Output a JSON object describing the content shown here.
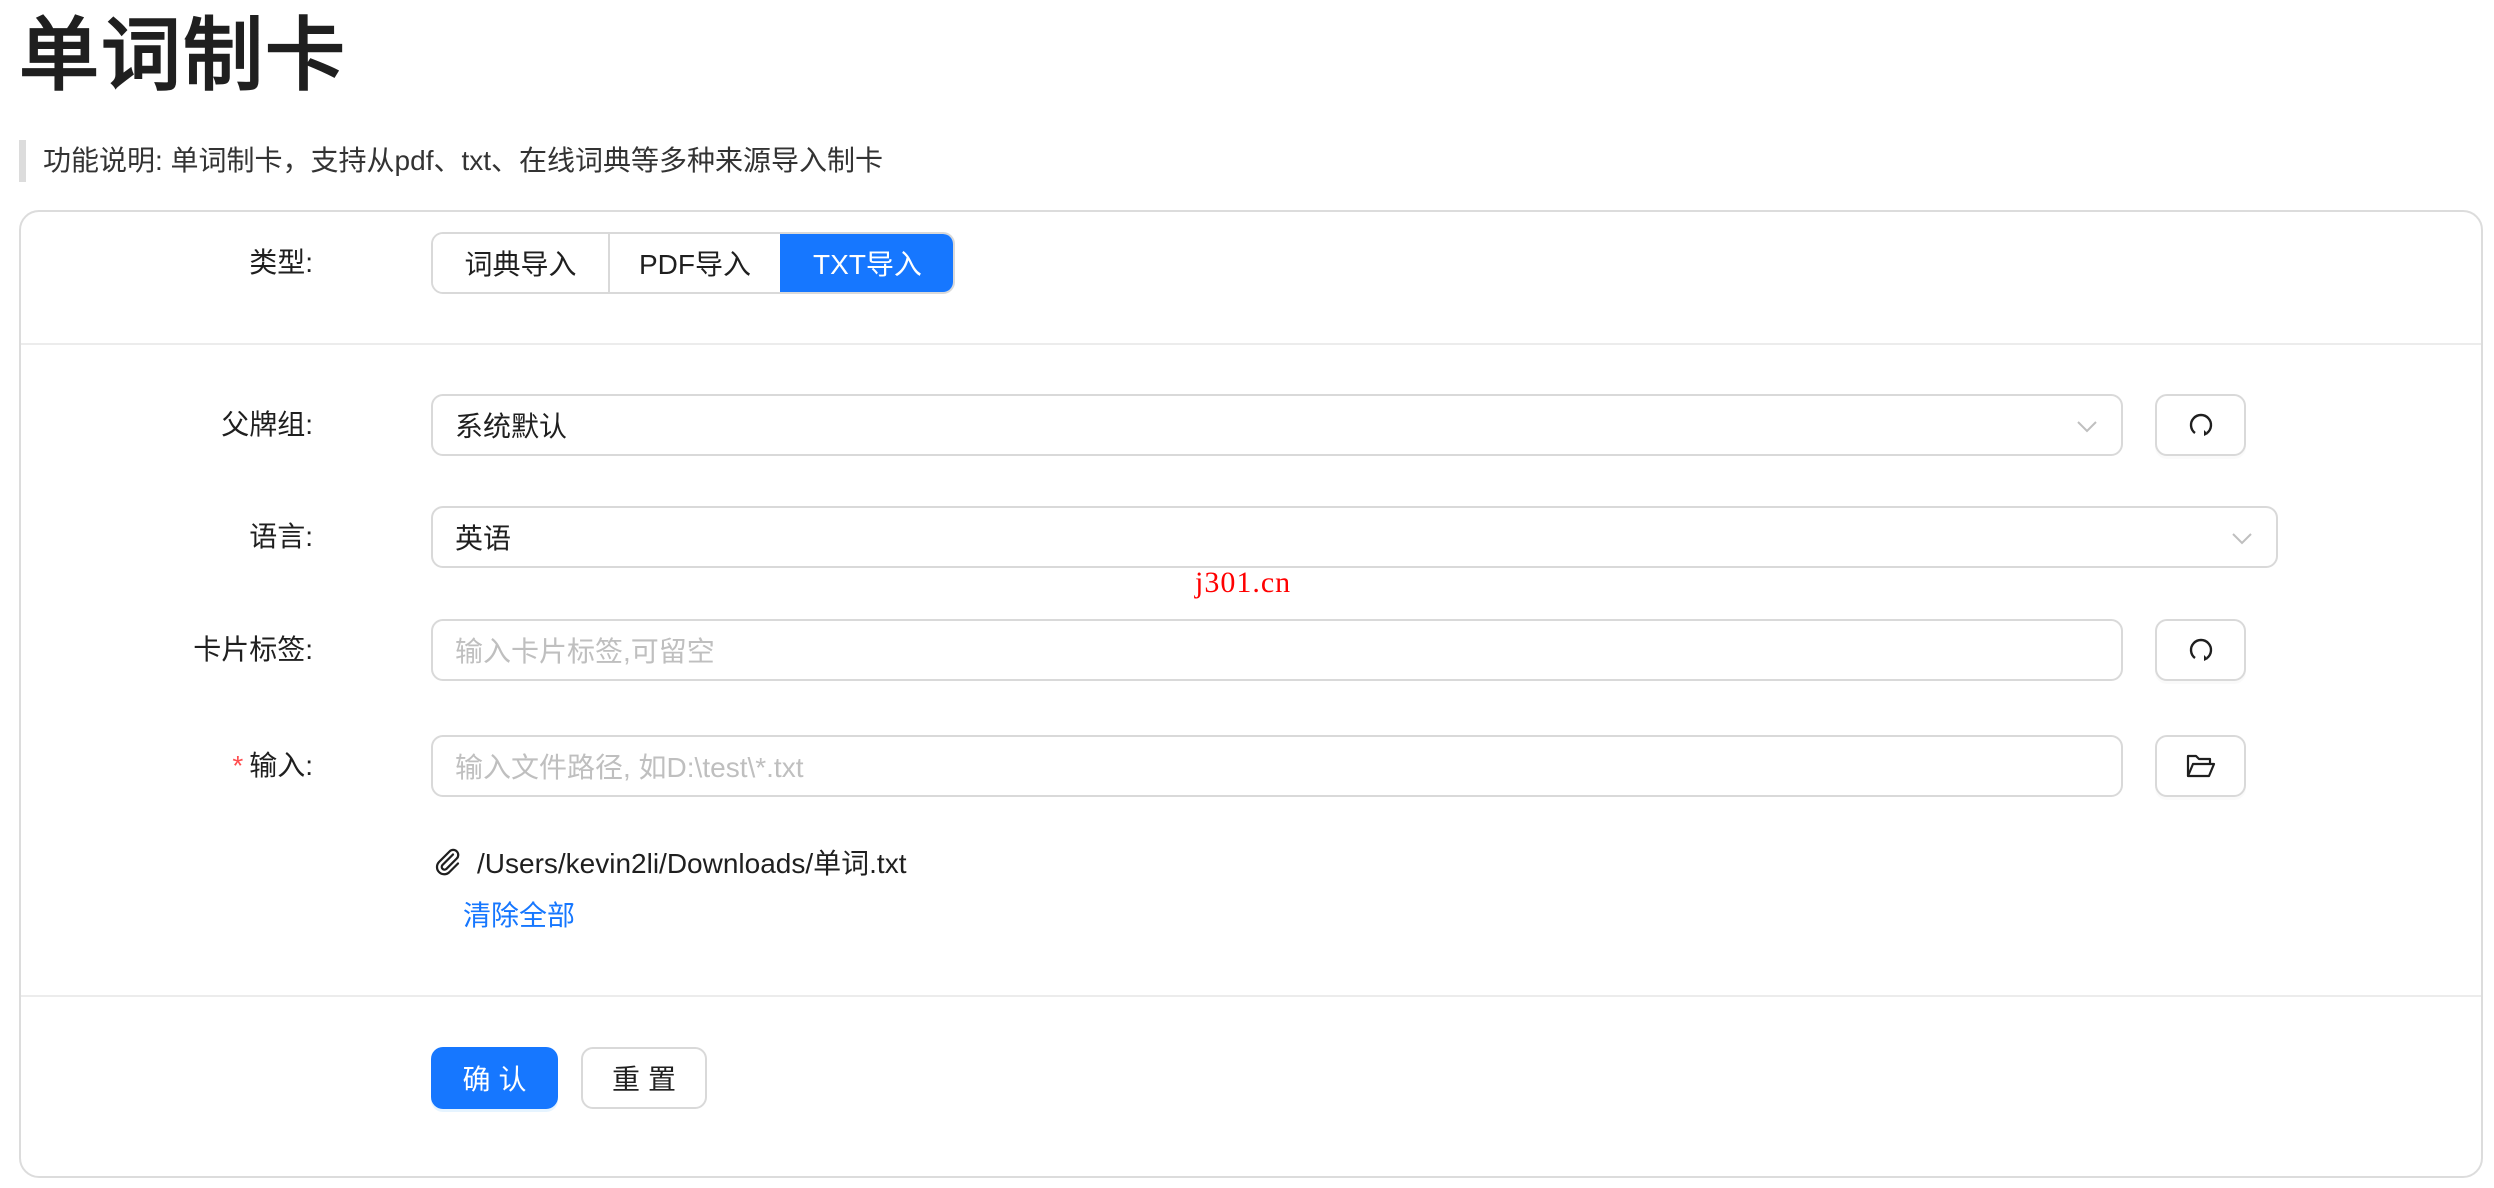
{
  "page": {
    "title": "单词制卡",
    "description": "功能说明: 单词制卡，支持从pdf、txt、在线词典等多种来源导入制卡"
  },
  "form": {
    "type": {
      "label": "类型:",
      "options": [
        "词典导入",
        "PDF导入",
        "TXT导入"
      ],
      "selected": "TXT导入"
    },
    "parent_deck": {
      "label": "父牌组:",
      "value": "系统默认",
      "refresh_icon": "refresh-icon"
    },
    "language": {
      "label": "语言:",
      "value": "英语"
    },
    "card_tags": {
      "label": "卡片标签:",
      "placeholder": "输入卡片标签,可留空",
      "value": "",
      "refresh_icon": "refresh-icon"
    },
    "input": {
      "required_mark": "*",
      "label": "输入:",
      "placeholder": "输入文件路径, 如D:\\test\\*.txt",
      "value": "",
      "browse_icon": "folder-open-icon"
    },
    "files": [
      {
        "icon": "paperclip-icon",
        "path": "/Users/kevin2li/Downloads/单词.txt"
      }
    ],
    "clear_all_label": "清除全部",
    "confirm_label": "确认",
    "reset_label": "重置"
  },
  "watermark": "j301.cn",
  "colors": {
    "primary": "#1677ff",
    "required": "#ff4d4f",
    "border": "#d9d9d9",
    "placeholder": "#bfbfbf",
    "watermark": "#ff0000"
  }
}
